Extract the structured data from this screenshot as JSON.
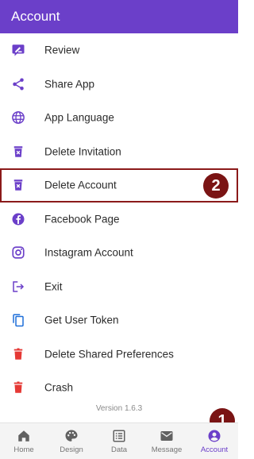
{
  "appbar": {
    "title": "Account"
  },
  "colors": {
    "primary": "#6b3fc9",
    "danger": "#e53935",
    "marker": "#7a1414"
  },
  "menu": {
    "items": [
      {
        "label": "Review",
        "icon": "rate-review-icon"
      },
      {
        "label": "Share App",
        "icon": "share-icon"
      },
      {
        "label": "App Language",
        "icon": "globe-icon"
      },
      {
        "label": "Delete Invitation",
        "icon": "delete-forever-icon"
      },
      {
        "label": "Delete Account",
        "icon": "delete-forever-icon"
      },
      {
        "label": "Facebook Page",
        "icon": "facebook-icon"
      },
      {
        "label": "Instagram Account",
        "icon": "instagram-icon"
      },
      {
        "label": "Exit",
        "icon": "logout-icon"
      },
      {
        "label": "Get User Token",
        "icon": "copy-icon"
      },
      {
        "label": "Delete Shared Preferences",
        "icon": "trash-icon"
      },
      {
        "label": "Crash",
        "icon": "trash-icon"
      }
    ]
  },
  "markers": {
    "account_tab": "1",
    "delete_account": "2"
  },
  "version": "Version 1.6.3",
  "bottom_nav": {
    "tabs": [
      {
        "label": "Home",
        "icon": "home-icon"
      },
      {
        "label": "Design",
        "icon": "palette-icon"
      },
      {
        "label": "Data",
        "icon": "list-icon"
      },
      {
        "label": "Message",
        "icon": "mail-icon"
      },
      {
        "label": "Account",
        "icon": "account-circle-icon",
        "active": true
      }
    ]
  }
}
